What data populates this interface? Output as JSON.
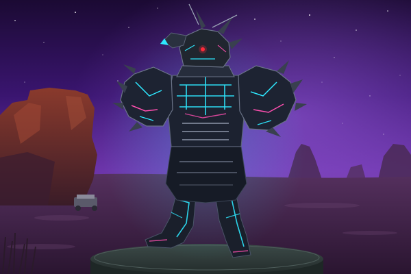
{
  "scene": {
    "view": "character-model-preview",
    "backdrop": "purple-night-desert",
    "subject": "armored-dragon-warrior",
    "subject_features": [
      "spiked-pauldrons",
      "cyan-glowing-circuit-lines",
      "pink-glowing-accents",
      "horned-dragon-helmet",
      "red-eyes"
    ],
    "stand": "round-dark-pedestal",
    "colors": {
      "sky_top": "#2a0f4d",
      "sky_mid": "#5a2696",
      "sky_glow": "#8b4fd0",
      "ground": "#3e2240",
      "rock": "#6b2a24",
      "armor": "#1c2230",
      "armor_edge": "#5b6478",
      "glow_cyan": "#2ee8ff",
      "glow_pink": "#ff4fb0",
      "eye_red": "#ff2a3a",
      "pedestal": "#2f3b3a"
    }
  }
}
